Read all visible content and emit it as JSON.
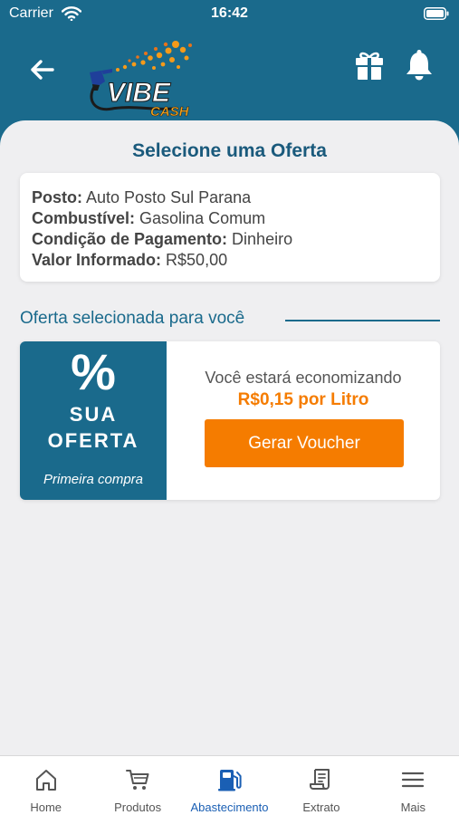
{
  "status_bar": {
    "carrier": "Carrier",
    "time": "16:42"
  },
  "header": {
    "logo_text": "VIBE",
    "logo_subtext": "CASH"
  },
  "page_title": "Selecione uma Oferta",
  "info": {
    "posto_label": "Posto:",
    "posto_value": "Auto Posto Sul Parana",
    "combustivel_label": "Combustível:",
    "combustivel_value": "Gasolina Comum",
    "pagamento_label": "Condição de Pagamento:",
    "pagamento_value": "Dinheiro",
    "valor_label": "Valor Informado:",
    "valor_value": "R$50,00"
  },
  "section_title": "Oferta selecionada para você",
  "offer": {
    "percent": "%",
    "label_line1": "SUA",
    "label_line2": "OFERTA",
    "sub": "Primeira compra",
    "savings_text": "Você estará economizando",
    "savings_value": "R$0,15 por Litro",
    "button_label": "Gerar Voucher"
  },
  "tabs": [
    {
      "label": "Home",
      "icon": "home-icon"
    },
    {
      "label": "Produtos",
      "icon": "cart-icon"
    },
    {
      "label": "Abastecimento",
      "icon": "fuel-icon",
      "active": true
    },
    {
      "label": "Extrato",
      "icon": "receipt-icon"
    },
    {
      "label": "Mais",
      "icon": "menu-icon"
    }
  ],
  "colors": {
    "primary": "#1a6a8c",
    "accent": "#f57c00",
    "active_tab": "#1a5fb4",
    "background": "#efeff1"
  }
}
